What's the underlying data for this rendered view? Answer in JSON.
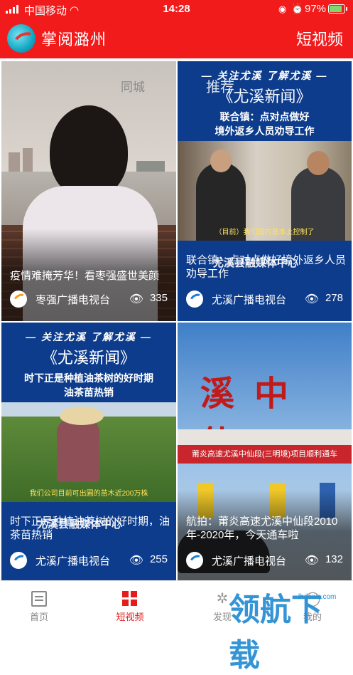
{
  "status": {
    "carrier": "中国移动",
    "time": "14:28",
    "battery": "97%"
  },
  "header": {
    "title": "掌阅潞州",
    "right_link": "短视频"
  },
  "cards": [
    {
      "tag": "同城",
      "title": "疫情难掩芳华！看枣强盛世美颜",
      "source": "枣强广播电视台",
      "views": "335"
    },
    {
      "push": "推荐",
      "kicker": "— 关注尤溪  了解尤溪 —",
      "brand": "《尤溪新闻》",
      "headline1": "联合镇：点对点做好",
      "headline2": "境外返乡人员劝导工作",
      "caption": "（目前）我们国内基本上控制了",
      "title": "联合镇：点对点做好境外返乡人员劝导工作",
      "watermark": "尤溪县融媒体中心",
      "source": "尤溪广播电视台",
      "views": "278"
    },
    {
      "kicker": "— 关注尤溪  了解尤溪 —",
      "brand": "《尤溪新闻》",
      "headline1": "时下正是种植油茶树的好时期",
      "headline2": "油茶苗热销",
      "caption": "我们公司目前可出圃的苗木近200万株",
      "title": "时下正是种植油茶树的好时期，油茶苗热销",
      "watermark": "尤溪县融媒体中心",
      "source": "尤溪广播电视台",
      "views": "255"
    },
    {
      "chars": "溪中仙",
      "banner": "莆炎高速尤溪中仙段(三明境)项目顺利通车",
      "title": "航拍：莆炎高速尤溪中仙段2010年-2020年，今天通车啦",
      "source": "尤溪广播电视台",
      "views": "132"
    }
  ],
  "tabs": [
    {
      "label": "首页",
      "icon": "home-icon"
    },
    {
      "label": "短视频",
      "icon": "video-grid-icon"
    },
    {
      "label": "发现",
      "icon": "discover-icon"
    },
    {
      "label": "我的",
      "icon": "profile-icon"
    }
  ],
  "watermark": {
    "big": "领航下载",
    "site": "lhdown.com"
  }
}
